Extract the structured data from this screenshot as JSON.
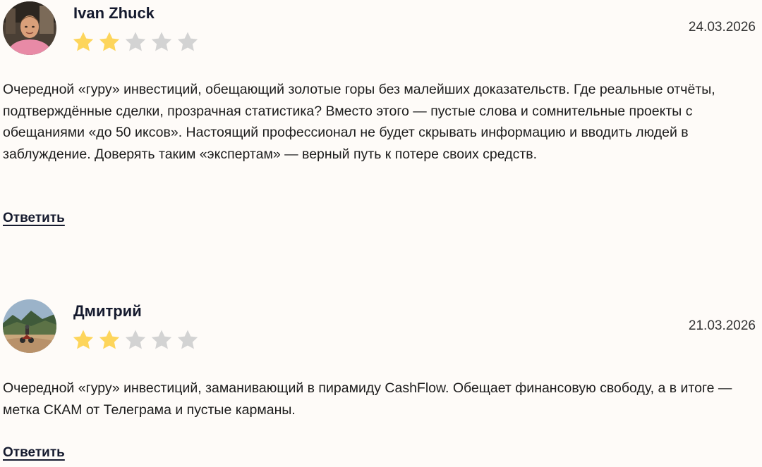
{
  "reviews": [
    {
      "author": "Ivan Zhuck",
      "date": "24.03.2026",
      "rating": 2,
      "max_rating": 5,
      "avatar_icon": "user-photo-man-outdoor",
      "text": "Очередной «гуру» инвестиций, обещающий золотые горы без малейших доказательств. Где реальные отчёты, подтверждённые сделки, прозрачная статистика? Вместо этого — пустые слова и сомнительные проекты с обещаниями «до 50 иксов». Настоящий профессионал не будет скрывать информацию и вводить людей в заблуждение. Доверять таким «экспертам» — верный путь к потере своих средств.",
      "reply_label": "Ответить"
    },
    {
      "author": "Дмитрий",
      "date": "21.03.2026",
      "rating": 2,
      "max_rating": 5,
      "avatar_icon": "user-photo-motorcycle-landscape",
      "text": "Очередной «гуру» инвестиций, заманивающий в пирамиду CashFlow. Обещает финансовую свободу, а в итоге — метка СКАМ от Телеграма и пустые карманы.",
      "reply_label": "Ответить"
    }
  ],
  "colors": {
    "star_filled": "#fdd55b",
    "star_empty": "#d3d3d3",
    "background": "#fefbf8",
    "heading": "#151a2e"
  }
}
